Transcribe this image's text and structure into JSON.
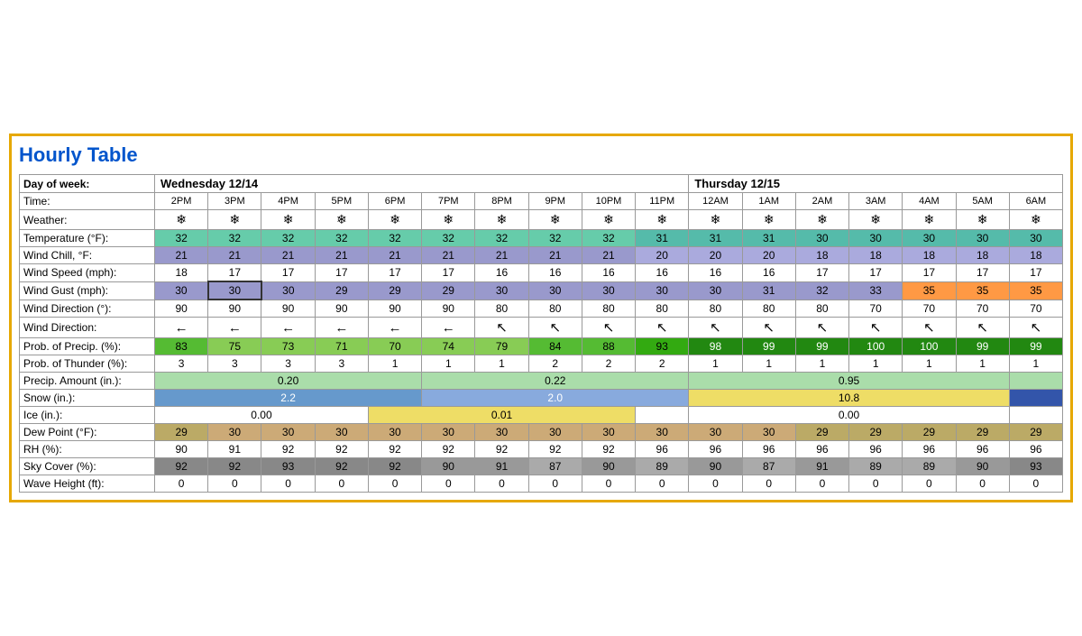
{
  "title": "Hourly Table",
  "days": {
    "wed": "Wednesday 12/14",
    "thu": "Thursday 12/15"
  },
  "times": [
    "2PM",
    "3PM",
    "4PM",
    "5PM",
    "6PM",
    "7PM",
    "8PM",
    "9PM",
    "10PM",
    "11PM",
    "12AM",
    "1AM",
    "2AM",
    "3AM",
    "4AM",
    "5AM",
    "6AM"
  ],
  "rows": {
    "weather_label": "Weather:",
    "temp_label": "Temperature (°F):",
    "windchill_label": "Wind Chill, °F:",
    "windspeed_label": "Wind Speed (mph):",
    "windgust_label": "Wind Gust (mph):",
    "winddir_deg_label": "Wind Direction (°):",
    "winddir_label": "Wind Direction:",
    "precip_prob_label": "Prob. of Precip. (%):",
    "thunder_label": "Prob. of Thunder (%):",
    "precip_amt_label": "Precip. Amount (in.):",
    "snow_label": "Snow (in.):",
    "ice_label": "Ice (in.):",
    "dew_label": "Dew Point (°F):",
    "rh_label": "RH (%):",
    "sky_label": "Sky Cover (%):",
    "wave_label": "Wave Height (ft):"
  },
  "temp": [
    32,
    32,
    32,
    32,
    32,
    32,
    32,
    32,
    32,
    31,
    31,
    31,
    30,
    30,
    30,
    30,
    30
  ],
  "windchill": [
    21,
    21,
    21,
    21,
    21,
    21,
    21,
    21,
    21,
    20,
    20,
    20,
    18,
    18,
    18,
    18,
    18
  ],
  "windspeed": [
    18,
    17,
    17,
    17,
    17,
    17,
    16,
    16,
    16,
    16,
    16,
    16,
    17,
    17,
    17,
    17,
    17
  ],
  "windgust": [
    30,
    30,
    30,
    29,
    29,
    29,
    30,
    30,
    30,
    30,
    30,
    31,
    32,
    33,
    35,
    35,
    35
  ],
  "winddir_deg": [
    90,
    90,
    90,
    90,
    90,
    90,
    80,
    80,
    80,
    80,
    80,
    80,
    80,
    70,
    70,
    70,
    70
  ],
  "precip_prob": [
    83,
    75,
    73,
    71,
    70,
    74,
    79,
    84,
    88,
    93,
    98,
    99,
    99,
    100,
    100,
    99,
    99
  ],
  "thunder": [
    3,
    3,
    3,
    3,
    1,
    1,
    1,
    2,
    2,
    2,
    1,
    1,
    1,
    1,
    1,
    1,
    1
  ],
  "dew": [
    29,
    30,
    30,
    30,
    30,
    30,
    30,
    30,
    30,
    30,
    30,
    30,
    29,
    29,
    29,
    29,
    29
  ],
  "rh": [
    90,
    91,
    92,
    92,
    92,
    92,
    92,
    92,
    92,
    96,
    96,
    96,
    96,
    96,
    96,
    96,
    96
  ],
  "sky": [
    92,
    92,
    93,
    92,
    92,
    90,
    91,
    87,
    90,
    89,
    90,
    87,
    91,
    89,
    89,
    90,
    93
  ],
  "wave": [
    0,
    0,
    0,
    0,
    0,
    0,
    0,
    0,
    0,
    0,
    0,
    0,
    0,
    0,
    0,
    0,
    0
  ],
  "precip_spans": [
    {
      "label": "0.20",
      "start": 0,
      "span": 5
    },
    {
      "label": "0.22",
      "start": 5,
      "span": 5
    },
    {
      "label": "0.95",
      "start": 10,
      "span": 6
    },
    {
      "label": "",
      "start": 16,
      "span": 1
    }
  ],
  "snow_spans": [
    {
      "label": "2.2",
      "start": 0,
      "span": 5
    },
    {
      "label": "2.0",
      "start": 5,
      "span": 5
    },
    {
      "label": "10.8",
      "start": 10,
      "span": 6
    },
    {
      "label": "",
      "start": 16,
      "span": 1
    }
  ],
  "ice_spans": [
    {
      "label": "0.00",
      "start": 0,
      "span": 4
    },
    {
      "label": "0.01",
      "start": 4,
      "span": 5
    },
    {
      "label": "",
      "start": 9,
      "span": 1
    },
    {
      "label": "0.00",
      "start": 10,
      "span": 6
    },
    {
      "label": "",
      "start": 16,
      "span": 1
    }
  ]
}
